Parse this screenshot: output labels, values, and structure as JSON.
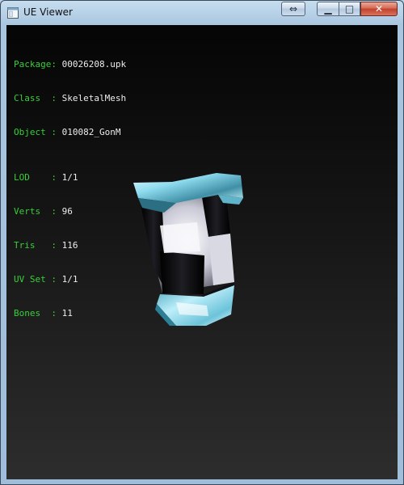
{
  "window": {
    "title": "UE Viewer",
    "app_icon": "window-app-icon",
    "controls": [
      {
        "name": "resize-button",
        "icon": "double-arrow-icon",
        "glyph": "⇔"
      },
      {
        "name": "minimize-button",
        "icon": "minimize-icon",
        "glyph": "▁"
      },
      {
        "name": "maximize-button",
        "icon": "maximize-icon",
        "glyph": "□"
      },
      {
        "name": "close-button",
        "icon": "close-icon",
        "glyph": "✕"
      }
    ]
  },
  "info": {
    "package_key": "Package:",
    "package_value": "00026208.upk",
    "class_key": "Class  :",
    "class_value": "SkeletalMesh",
    "object_key": "Object :",
    "object_value": "010082_GonM",
    "lod_key": "LOD    :",
    "lod_value": "1/1",
    "verts_key": "Verts  :",
    "verts_value": "96",
    "tris_key": "Tris   :",
    "tris_value": "116",
    "uvset_key": "UV Set :",
    "uvset_value": "1/1",
    "bones_key": "Bones  :",
    "bones_value": "11"
  },
  "colors": {
    "label": "#36d136",
    "value": "#ececec",
    "viewport_top": "#050505",
    "viewport_bottom": "#2d2d2d",
    "mesh_cyan": "#7fd7ee"
  }
}
